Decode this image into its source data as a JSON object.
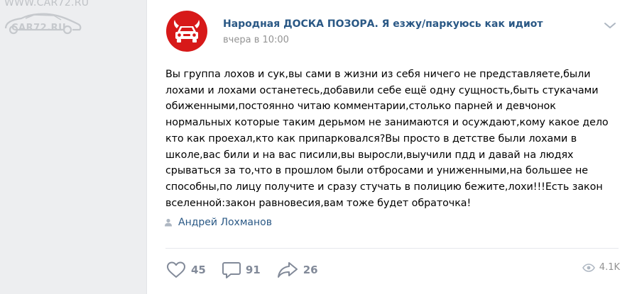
{
  "watermark": {
    "line1": "WWW.CAR72.RU",
    "line2": "CAR72.RU"
  },
  "post": {
    "group_name": "Народная ДОСКА ПОЗОРА. Я езжу/паркуюсь как идиот",
    "time": "вчера в 10:00",
    "text": "Вы группа лохов и сук,вы сами в жизни из себя ничего не представляете,были\nлохами и лохами останетесь,добавили себе ещё одну сущность,быть стукачами\nобиженными,постоянно читаю комментарии,столько парней и девчонок\nнормальных которые таким дерьмом не занимаются и осуждают,кому какое дело\nкто как проехал,кто как припарковался?Вы просто в детстве были лохами в\nшколе,вас били и на вас писили,вы выросли,выучили пдд и давай на людях\nсрываться за то,что в прошлом были отбросами и униженными,на большее не\nспособны,по лицу получите и сразу стучать в полицию бежите,лохи!!!Есть закон\nвселенной:закон равновесия,вам тоже будет обраточка!",
    "signer": "Андрей Лохманов"
  },
  "actions": {
    "likes": "45",
    "comments": "91",
    "shares": "26",
    "views": "4.1K"
  },
  "colors": {
    "link": "#2a5885",
    "avatar_bg": "#d71919",
    "icon": "#828a99"
  },
  "icons": [
    "car-logo-icon",
    "chevron-down-icon",
    "user-icon",
    "heart-icon",
    "comment-icon",
    "share-icon",
    "eye-icon"
  ]
}
